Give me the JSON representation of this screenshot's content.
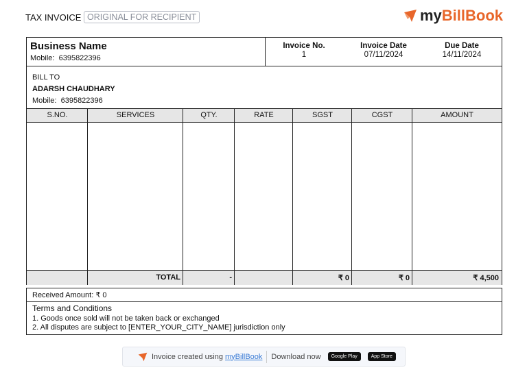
{
  "header": {
    "title": "TAX INVOICE",
    "copy_badge": "ORIGINAL FOR RECIPIENT",
    "brand": {
      "my": "my",
      "name": "BillBook"
    },
    "brand_color": "#e8662a"
  },
  "business": {
    "name": "Business Name",
    "mobile_label": "Mobile:",
    "mobile": "6395822396"
  },
  "invoice": {
    "no_label": "Invoice No.",
    "no": "1",
    "date_label": "Invoice Date",
    "date": "07/11/2024",
    "due_label": "Due Date",
    "due": "14/11/2024"
  },
  "bill_to": {
    "label": "BILL TO",
    "name": "ADARSH CHAUDHARY",
    "mobile_label": "Mobile:",
    "mobile": "6395822396"
  },
  "table": {
    "columns": [
      "S.NO.",
      "SERVICES",
      "QTY.",
      "RATE",
      "SGST",
      "CGST",
      "AMOUNT"
    ],
    "total": {
      "label": "TOTAL",
      "qty": "-",
      "sgst": "₹ 0",
      "cgst": "₹ 0",
      "amount": "₹ 4,500"
    }
  },
  "received": {
    "label": "Received Amount:",
    "value": "₹ 0"
  },
  "terms": {
    "title": "Terms and Conditions",
    "items": [
      "1. Goods once sold will not be taken back or exchanged",
      "2. All disputes are subject to [ENTER_YOUR_CITY_NAME] jurisdiction only"
    ]
  },
  "footer": {
    "created": "Invoice created using",
    "brand_link": "myBillBook",
    "download": "Download now",
    "google": "Google Play",
    "apple": "App Store"
  }
}
